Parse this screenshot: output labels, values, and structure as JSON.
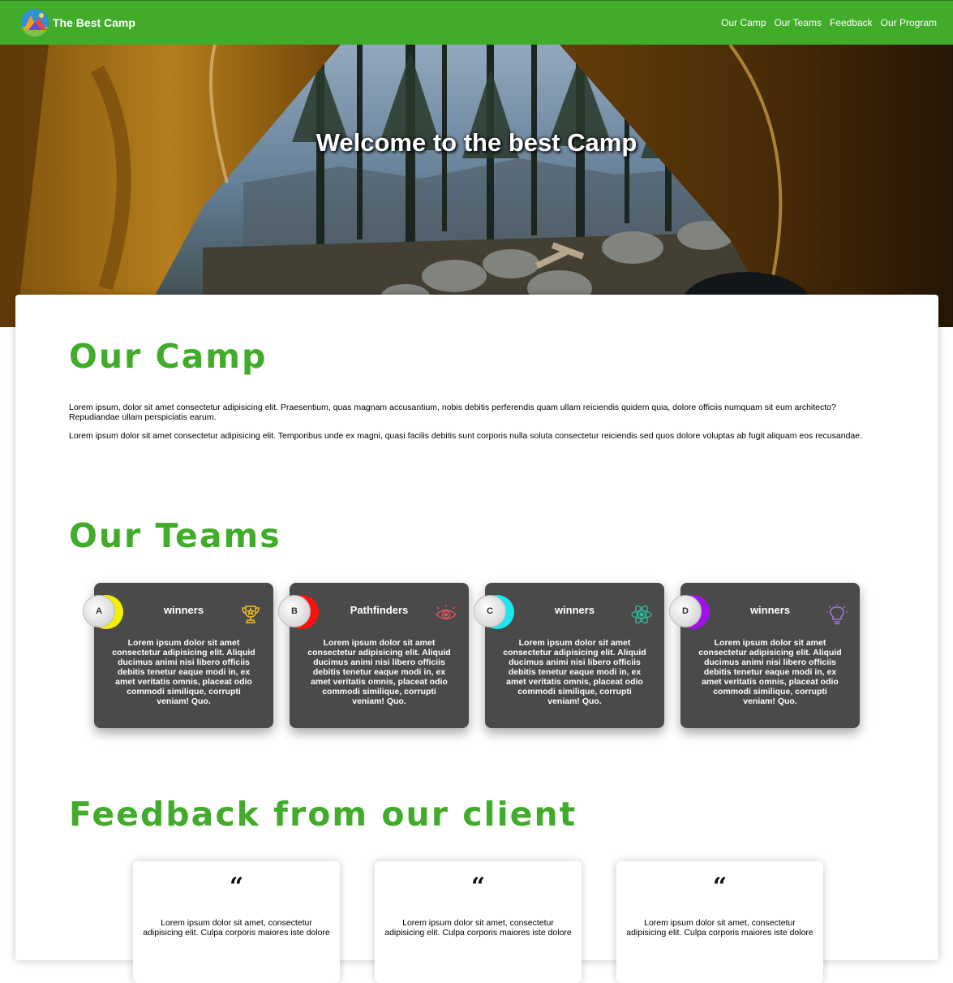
{
  "brand": {
    "name": "The Best Camp",
    "color": "#41ac2a"
  },
  "nav": {
    "items": [
      "Our Camp",
      "Our Teams",
      "Feedback",
      "Our Program"
    ]
  },
  "hero": {
    "title": "Welcome to the best Camp"
  },
  "camp": {
    "title": "Our Camp",
    "paragraphs": [
      "Lorem ipsum, dolor sit amet consectetur adipisicing elit. Praesentium, quas magnam accusantium, nobis debitis perferendis quam ullam reiciendis quidem quia, dolore officiis numquam sit eum architecto? Repudiandae ullam perspiciatis earum.",
      "Lorem ipsum dolor sit amet consectetur adipisicing elit. Temporibus unde ex magni, quasi facilis debitis sunt corporis nulla soluta consectetur reiciendis sed quos dolore voluptas ab fugit aliquam eos recusandae."
    ]
  },
  "teams": {
    "title": "Our Teams",
    "cards": [
      {
        "letter": "A",
        "name": "winners",
        "icon": "trophy-icon",
        "accent": "#f5f000",
        "text": "Lorem ipsum dolor sit amet consectetur adipisicing elit. Aliquid ducimus animi nisi libero officiis debitis tenetur eaque modi in, ex amet veritatis omnis, placeat odio commodi similique, corrupti veniam! Quo."
      },
      {
        "letter": "B",
        "name": "Pathfinders",
        "icon": "eye-icon",
        "accent": "#ff1010",
        "text": "Lorem ipsum dolor sit amet consectetur adipisicing elit. Aliquid ducimus animi nisi libero officiis debitis tenetur eaque modi in, ex amet veritatis omnis, placeat odio commodi similique, corrupti veniam! Quo."
      },
      {
        "letter": "C",
        "name": "winners",
        "icon": "atom-icon",
        "accent": "#19e8ee",
        "text": "Lorem ipsum dolor sit amet consectetur adipisicing elit. Aliquid ducimus animi nisi libero officiis debitis tenetur eaque modi in, ex amet veritatis omnis, placeat odio commodi similique, corrupti veniam! Quo."
      },
      {
        "letter": "D",
        "name": "winners",
        "icon": "lightbulb-icon",
        "accent": "#a212e8",
        "text": "Lorem ipsum dolor sit amet consectetur adipisicing elit. Aliquid ducimus animi nisi libero officiis debitis tenetur eaque modi in, ex amet veritatis omnis, placeat odio commodi similique, corrupti veniam! Quo."
      }
    ]
  },
  "feedback": {
    "title": "Feedback from our client",
    "quote_mark": "“",
    "cards": [
      {
        "text": "Lorem ipsum dolor sit amet, consectetur adipisicing elit. Culpa corporis maiores iste dolore"
      },
      {
        "text": "Lorem ipsum dolor sit amet, consectetur adipisicing elit. Culpa corporis maiores iste dolore"
      },
      {
        "text": "Lorem ipsum dolor sit amet, consectetur adipisicing elit. Culpa corporis maiores iste dolore"
      }
    ]
  }
}
